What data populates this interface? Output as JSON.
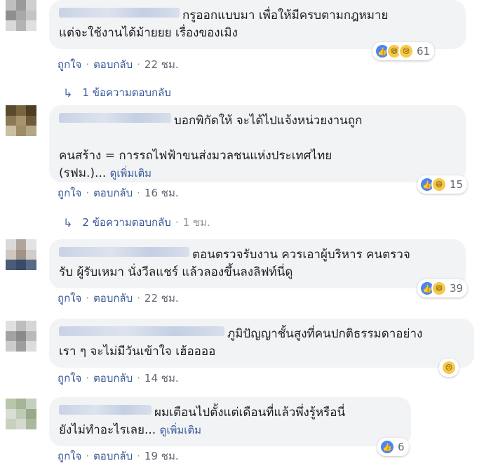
{
  "comments": [
    {
      "text": "กรูออกแบบมา เพื่อให้มีครบตามกฎหมาย\nแต่จะใช้งานได้ม้ายยย เรื่องของเมิง",
      "see_more": "",
      "reaction_count": "61",
      "reactions": [
        "like-icon",
        "haha-icon",
        "sad-icon"
      ],
      "like_label": "ถูกใจ",
      "reply_label": "ตอบกลับ",
      "time": "22 ชม.",
      "replies_label": "1 ข้อความตอบกลับ",
      "replies_time": ""
    },
    {
      "text": "บอกพิกัดให้ จะได้ไปแจ้งหน่วยงานถูก\n\nคนสร้าง = การรถไฟฟ้าขนส่งมวลชนแห่งประเทศไทย\n(รฟม.)... ",
      "see_more": "ดูเพิ่มเติม",
      "reaction_count": "15",
      "reactions": [
        "like-icon",
        "haha-icon"
      ],
      "like_label": "ถูกใจ",
      "reply_label": "ตอบกลับ",
      "time": "16 ชม.",
      "replies_label": "2 ข้อความตอบกลับ",
      "replies_time": "1 ชม."
    },
    {
      "text": "ตอนตรวจรับงาน ควรเอาผู้บริหาร คนตรวจ\nรับ ผู้รับเหมา นั่งวีลแชร์ แล้วลองขึ้นลงลิฟท์นี่ดู",
      "see_more": "",
      "reaction_count": "39",
      "reactions": [
        "like-icon",
        "haha-icon"
      ],
      "like_label": "ถูกใจ",
      "reply_label": "ตอบกลับ",
      "time": "22 ชม."
    },
    {
      "text": "ภูมิปัญญาชั้นสูงที่คนปกติธรรมดาอย่าง\nเรา ๆ จะไม่มีวันเข้าใจ เฮ้ออออ",
      "see_more": "",
      "reaction_count": "",
      "reactions": [
        "sad-icon"
      ],
      "like_label": "ถูกใจ",
      "reply_label": "ตอบกลับ",
      "time": "14 ชม."
    },
    {
      "text": "ผมเตือนไปตั้งแต่เดือนที่แล้วพึ่งรู้หรือนี่\nยังไม่ทำอะไรเลย... ",
      "see_more": "ดูเพิ่มเติม",
      "reaction_count": "6",
      "reactions": [
        "like-icon"
      ],
      "like_label": "ถูกใจ",
      "reply_label": "ตอบกลับ",
      "time": "19 ชม."
    }
  ],
  "separator": "·"
}
